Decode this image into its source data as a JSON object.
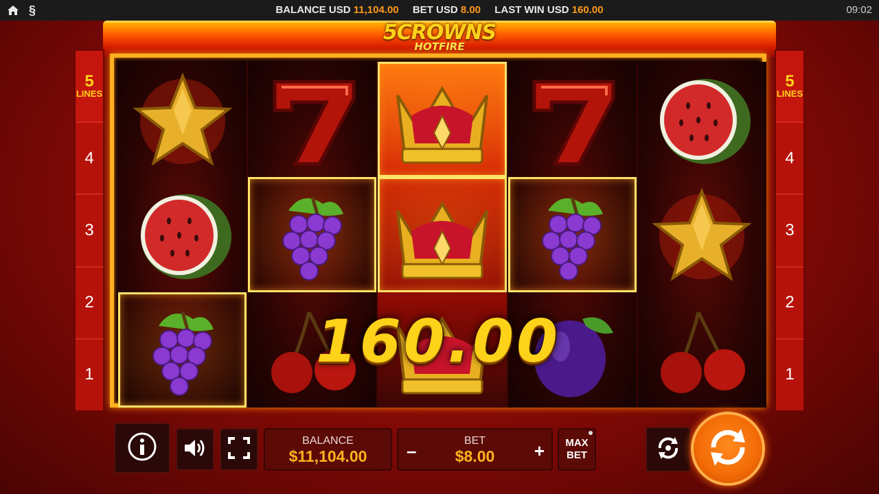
{
  "topbar": {
    "balance_label": "BALANCE USD",
    "balance_value": "11,104.00",
    "bet_label": "BET USD",
    "bet_value": "8.00",
    "last_win_label": "LAST WIN USD",
    "last_win_value": "160.00",
    "clock": "09:02",
    "paragraph_glyph": "§"
  },
  "logo": {
    "title": "5CROWNS",
    "subtitle": "HOTFIRE"
  },
  "lines_panel": {
    "top_number": "5",
    "top_word": "LINES",
    "rows": [
      "4",
      "3",
      "2",
      "1"
    ]
  },
  "reels": [
    [
      "star",
      "watermelon",
      "grapes"
    ],
    [
      "seven",
      "grapes",
      "cherries"
    ],
    [
      "crown",
      "crown",
      "crown"
    ],
    [
      "seven",
      "grapes",
      "plum"
    ],
    [
      "watermelon",
      "star",
      "cherries"
    ]
  ],
  "win_amount": "160.00",
  "controls": {
    "balance_label": "BALANCE",
    "balance_value": "$11,104.00",
    "bet_label": "BET",
    "bet_value": "$8.00",
    "minus": "–",
    "plus": "+",
    "max_label_1": "MAX",
    "max_label_2": "BET"
  },
  "icons": {
    "home": "home-icon",
    "info": "info-icon",
    "sound": "speaker-icon",
    "fullscreen": "fullscreen-icon",
    "autoplay": "autoplay-icon",
    "spin": "spin-icon"
  },
  "colors": {
    "accent": "#ff9a1e",
    "win_text": "#ffd21a",
    "spin_button": "#f26a06"
  }
}
